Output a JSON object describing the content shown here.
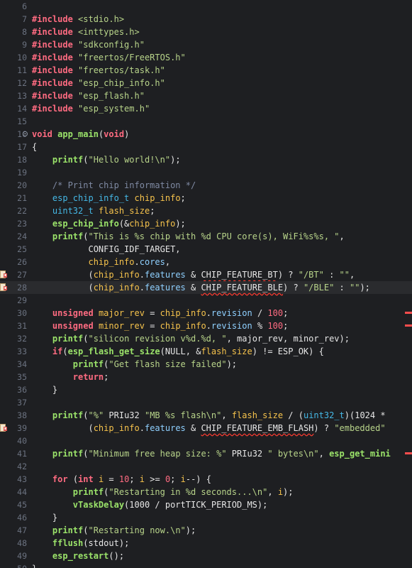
{
  "editor": {
    "lines": [
      {
        "num": "6",
        "tokens": []
      },
      {
        "num": "7",
        "tokens": [
          {
            "t": "#include",
            "c": "kw"
          },
          {
            "t": " ",
            "c": "plain"
          },
          {
            "t": "<stdio.h>",
            "c": "str"
          }
        ]
      },
      {
        "num": "8",
        "tokens": [
          {
            "t": "#include",
            "c": "kw"
          },
          {
            "t": " ",
            "c": "plain"
          },
          {
            "t": "<inttypes.h>",
            "c": "str"
          }
        ]
      },
      {
        "num": "9",
        "tokens": [
          {
            "t": "#include",
            "c": "kw"
          },
          {
            "t": " ",
            "c": "plain"
          },
          {
            "t": "\"sdkconfig.h\"",
            "c": "str"
          }
        ]
      },
      {
        "num": "10",
        "tokens": [
          {
            "t": "#include",
            "c": "kw"
          },
          {
            "t": " ",
            "c": "plain"
          },
          {
            "t": "\"freertos/FreeRTOS.h\"",
            "c": "str"
          }
        ]
      },
      {
        "num": "11",
        "tokens": [
          {
            "t": "#include",
            "c": "kw"
          },
          {
            "t": " ",
            "c": "plain"
          },
          {
            "t": "\"freertos/task.h\"",
            "c": "str"
          }
        ]
      },
      {
        "num": "12",
        "tokens": [
          {
            "t": "#include",
            "c": "kw"
          },
          {
            "t": " ",
            "c": "plain"
          },
          {
            "t": "\"esp_chip_info.h\"",
            "c": "str"
          }
        ]
      },
      {
        "num": "13",
        "tokens": [
          {
            "t": "#include",
            "c": "kw"
          },
          {
            "t": " ",
            "c": "plain"
          },
          {
            "t": "\"esp_flash.h\"",
            "c": "str"
          }
        ]
      },
      {
        "num": "14",
        "tokens": [
          {
            "t": "#include",
            "c": "kw"
          },
          {
            "t": " ",
            "c": "plain"
          },
          {
            "t": "\"esp_system.h\"",
            "c": "str"
          }
        ]
      },
      {
        "num": "15",
        "tokens": []
      },
      {
        "num": "16",
        "fold": true,
        "tokens": [
          {
            "t": "void",
            "c": "kw"
          },
          {
            "t": " ",
            "c": "plain"
          },
          {
            "t": "app_main",
            "c": "fn"
          },
          {
            "t": "(",
            "c": "plain"
          },
          {
            "t": "void",
            "c": "kw"
          },
          {
            "t": ")",
            "c": "plain"
          }
        ]
      },
      {
        "num": "17",
        "tokens": [
          {
            "t": "{",
            "c": "plain"
          }
        ]
      },
      {
        "num": "18",
        "tokens": [
          {
            "t": "    ",
            "c": "plain"
          },
          {
            "t": "printf",
            "c": "fn"
          },
          {
            "t": "(",
            "c": "plain"
          },
          {
            "t": "\"Hello world!\\n\"",
            "c": "str"
          },
          {
            "t": ");",
            "c": "plain"
          }
        ]
      },
      {
        "num": "19",
        "tokens": []
      },
      {
        "num": "20",
        "tokens": [
          {
            "t": "    ",
            "c": "plain"
          },
          {
            "t": "/* Print chip information */",
            "c": "cmt"
          }
        ]
      },
      {
        "num": "21",
        "tokens": [
          {
            "t": "    ",
            "c": "plain"
          },
          {
            "t": "esp_chip_info_t",
            "c": "type"
          },
          {
            "t": " ",
            "c": "plain"
          },
          {
            "t": "chip_info",
            "c": "var"
          },
          {
            "t": ";",
            "c": "plain"
          }
        ]
      },
      {
        "num": "22",
        "tokens": [
          {
            "t": "    ",
            "c": "plain"
          },
          {
            "t": "uint32_t",
            "c": "type"
          },
          {
            "t": " ",
            "c": "plain"
          },
          {
            "t": "flash_size",
            "c": "var"
          },
          {
            "t": ";",
            "c": "plain"
          }
        ]
      },
      {
        "num": "23",
        "tokens": [
          {
            "t": "    ",
            "c": "plain"
          },
          {
            "t": "esp_chip_info",
            "c": "fn"
          },
          {
            "t": "(&",
            "c": "plain"
          },
          {
            "t": "chip_info",
            "c": "var"
          },
          {
            "t": ");",
            "c": "plain"
          }
        ]
      },
      {
        "num": "24",
        "tokens": [
          {
            "t": "    ",
            "c": "plain"
          },
          {
            "t": "printf",
            "c": "fn"
          },
          {
            "t": "(",
            "c": "plain"
          },
          {
            "t": "\"This is %s chip with %d CPU core(s), WiFi%s%s, \"",
            "c": "str"
          },
          {
            "t": ",",
            "c": "plain"
          }
        ]
      },
      {
        "num": "25",
        "tokens": [
          {
            "t": "           CONFIG_IDF_TARGET,",
            "c": "plain"
          }
        ]
      },
      {
        "num": "26",
        "tokens": [
          {
            "t": "           ",
            "c": "plain"
          },
          {
            "t": "chip_info",
            "c": "var"
          },
          {
            "t": ".",
            "c": "plain"
          },
          {
            "t": "cores",
            "c": "field"
          },
          {
            "t": ",",
            "c": "plain"
          }
        ]
      },
      {
        "num": "27",
        "marker": true,
        "tokens": [
          {
            "t": "           (",
            "c": "plain"
          },
          {
            "t": "chip_info",
            "c": "var"
          },
          {
            "t": ".",
            "c": "plain"
          },
          {
            "t": "features",
            "c": "field"
          },
          {
            "t": " & ",
            "c": "plain"
          },
          {
            "t": "CHIP_FEATURE_BT",
            "c": "plain",
            "err": true
          },
          {
            "t": ") ? ",
            "c": "plain"
          },
          {
            "t": "\"/BT\"",
            "c": "str"
          },
          {
            "t": " : ",
            "c": "plain"
          },
          {
            "t": "\"\"",
            "c": "str"
          },
          {
            "t": ",",
            "c": "plain"
          }
        ]
      },
      {
        "num": "28",
        "marker": true,
        "current": true,
        "tokens": [
          {
            "t": "           (",
            "c": "plain"
          },
          {
            "t": "chip_info",
            "c": "var"
          },
          {
            "t": ".",
            "c": "plain"
          },
          {
            "t": "features",
            "c": "field"
          },
          {
            "t": " & ",
            "c": "plain"
          },
          {
            "t": "CHIP_FEATURE_BLE",
            "c": "plain",
            "err": true
          },
          {
            "t": ") ? ",
            "c": "plain"
          },
          {
            "t": "\"/BLE\"",
            "c": "str"
          },
          {
            "t": " : ",
            "c": "plain"
          },
          {
            "t": "\"\"",
            "c": "str"
          },
          {
            "t": ");",
            "c": "plain"
          }
        ]
      },
      {
        "num": "29",
        "tokens": []
      },
      {
        "num": "30",
        "right": true,
        "tokens": [
          {
            "t": "    ",
            "c": "plain"
          },
          {
            "t": "unsigned",
            "c": "kw"
          },
          {
            "t": " ",
            "c": "plain"
          },
          {
            "t": "major_rev",
            "c": "var"
          },
          {
            "t": " = ",
            "c": "plain"
          },
          {
            "t": "chip_info",
            "c": "var"
          },
          {
            "t": ".",
            "c": "plain"
          },
          {
            "t": "revision",
            "c": "field"
          },
          {
            "t": " / ",
            "c": "plain"
          },
          {
            "t": "100",
            "c": "num"
          },
          {
            "t": ";",
            "c": "plain"
          }
        ]
      },
      {
        "num": "31",
        "right": true,
        "tokens": [
          {
            "t": "    ",
            "c": "plain"
          },
          {
            "t": "unsigned",
            "c": "kw"
          },
          {
            "t": " ",
            "c": "plain"
          },
          {
            "t": "minor_rev",
            "c": "var"
          },
          {
            "t": " = ",
            "c": "plain"
          },
          {
            "t": "chip_info",
            "c": "var"
          },
          {
            "t": ".",
            "c": "plain"
          },
          {
            "t": "revision",
            "c": "field"
          },
          {
            "t": " % ",
            "c": "plain"
          },
          {
            "t": "100",
            "c": "num"
          },
          {
            "t": ";",
            "c": "plain"
          }
        ]
      },
      {
        "num": "32",
        "tokens": [
          {
            "t": "    ",
            "c": "plain"
          },
          {
            "t": "printf",
            "c": "fn"
          },
          {
            "t": "(",
            "c": "plain"
          },
          {
            "t": "\"silicon revision v%d.%d, \"",
            "c": "str"
          },
          {
            "t": ", major_rev, minor_rev);",
            "c": "plain"
          }
        ]
      },
      {
        "num": "33",
        "tokens": [
          {
            "t": "    ",
            "c": "plain"
          },
          {
            "t": "if",
            "c": "kw"
          },
          {
            "t": "(",
            "c": "plain"
          },
          {
            "t": "esp_flash_get_size",
            "c": "fn"
          },
          {
            "t": "(NULL, &",
            "c": "plain"
          },
          {
            "t": "flash_size",
            "c": "var"
          },
          {
            "t": ") != ESP_OK) {",
            "c": "plain"
          }
        ]
      },
      {
        "num": "34",
        "tokens": [
          {
            "t": "        ",
            "c": "plain"
          },
          {
            "t": "printf",
            "c": "fn"
          },
          {
            "t": "(",
            "c": "plain"
          },
          {
            "t": "\"Get flash size failed\"",
            "c": "str"
          },
          {
            "t": ");",
            "c": "plain"
          }
        ]
      },
      {
        "num": "35",
        "tokens": [
          {
            "t": "        ",
            "c": "plain"
          },
          {
            "t": "return",
            "c": "kw"
          },
          {
            "t": ";",
            "c": "plain"
          }
        ]
      },
      {
        "num": "36",
        "tokens": [
          {
            "t": "    }",
            "c": "plain"
          }
        ]
      },
      {
        "num": "37",
        "tokens": []
      },
      {
        "num": "38",
        "tokens": [
          {
            "t": "    ",
            "c": "plain"
          },
          {
            "t": "printf",
            "c": "fn"
          },
          {
            "t": "(",
            "c": "plain"
          },
          {
            "t": "\"%\"",
            "c": "str"
          },
          {
            "t": " PRIu32 ",
            "c": "plain"
          },
          {
            "t": "\"MB %s flash\\n\"",
            "c": "str"
          },
          {
            "t": ", ",
            "c": "plain"
          },
          {
            "t": "flash_size",
            "c": "var"
          },
          {
            "t": " / (",
            "c": "plain"
          },
          {
            "t": "uint32_t",
            "c": "type"
          },
          {
            "t": ")(1024 *",
            "c": "plain"
          }
        ]
      },
      {
        "num": "39",
        "marker": true,
        "tokens": [
          {
            "t": "           (",
            "c": "plain"
          },
          {
            "t": "chip_info",
            "c": "var"
          },
          {
            "t": ".",
            "c": "plain"
          },
          {
            "t": "features",
            "c": "field"
          },
          {
            "t": " & ",
            "c": "plain"
          },
          {
            "t": "CHIP_FEATURE_EMB_FLASH",
            "c": "plain",
            "err": true
          },
          {
            "t": ") ? ",
            "c": "plain"
          },
          {
            "t": "\"embedded\"",
            "c": "str"
          }
        ]
      },
      {
        "num": "40",
        "tokens": []
      },
      {
        "num": "41",
        "right": true,
        "tokens": [
          {
            "t": "    ",
            "c": "plain"
          },
          {
            "t": "printf",
            "c": "fn"
          },
          {
            "t": "(",
            "c": "plain"
          },
          {
            "t": "\"Minimum free heap size: %\"",
            "c": "str"
          },
          {
            "t": " PRIu32 ",
            "c": "plain"
          },
          {
            "t": "\" bytes\\n\"",
            "c": "str"
          },
          {
            "t": ", ",
            "c": "plain"
          },
          {
            "t": "esp_get_mini",
            "c": "fn"
          }
        ]
      },
      {
        "num": "42",
        "tokens": []
      },
      {
        "num": "43",
        "tokens": [
          {
            "t": "    ",
            "c": "plain"
          },
          {
            "t": "for",
            "c": "kw"
          },
          {
            "t": " (",
            "c": "plain"
          },
          {
            "t": "int",
            "c": "kw"
          },
          {
            "t": " ",
            "c": "plain"
          },
          {
            "t": "i",
            "c": "var"
          },
          {
            "t": " = ",
            "c": "plain"
          },
          {
            "t": "10",
            "c": "num"
          },
          {
            "t": "; ",
            "c": "plain"
          },
          {
            "t": "i",
            "c": "var"
          },
          {
            "t": " >= ",
            "c": "plain"
          },
          {
            "t": "0",
            "c": "num"
          },
          {
            "t": "; ",
            "c": "plain"
          },
          {
            "t": "i",
            "c": "var"
          },
          {
            "t": "--) {",
            "c": "plain"
          }
        ]
      },
      {
        "num": "44",
        "tokens": [
          {
            "t": "        ",
            "c": "plain"
          },
          {
            "t": "printf",
            "c": "fn"
          },
          {
            "t": "(",
            "c": "plain"
          },
          {
            "t": "\"Restarting in %d seconds...\\n\"",
            "c": "str"
          },
          {
            "t": ", ",
            "c": "plain"
          },
          {
            "t": "i",
            "c": "var"
          },
          {
            "t": ");",
            "c": "plain"
          }
        ]
      },
      {
        "num": "45",
        "tokens": [
          {
            "t": "        ",
            "c": "plain"
          },
          {
            "t": "vTaskDelay",
            "c": "fn"
          },
          {
            "t": "(1000 / portTICK_PERIOD_MS);",
            "c": "plain"
          }
        ]
      },
      {
        "num": "46",
        "tokens": [
          {
            "t": "    }",
            "c": "plain"
          }
        ]
      },
      {
        "num": "47",
        "tokens": [
          {
            "t": "    ",
            "c": "plain"
          },
          {
            "t": "printf",
            "c": "fn"
          },
          {
            "t": "(",
            "c": "plain"
          },
          {
            "t": "\"Restarting now.\\n\"",
            "c": "str"
          },
          {
            "t": ");",
            "c": "plain"
          }
        ]
      },
      {
        "num": "48",
        "tokens": [
          {
            "t": "    ",
            "c": "plain"
          },
          {
            "t": "fflush",
            "c": "fn"
          },
          {
            "t": "(stdout);",
            "c": "plain"
          }
        ]
      },
      {
        "num": "49",
        "tokens": [
          {
            "t": "    ",
            "c": "plain"
          },
          {
            "t": "esp_restart",
            "c": "fn"
          },
          {
            "t": "();",
            "c": "plain"
          }
        ]
      },
      {
        "num": "50",
        "tokens": [
          {
            "t": "}",
            "c": "plain"
          }
        ]
      }
    ]
  }
}
